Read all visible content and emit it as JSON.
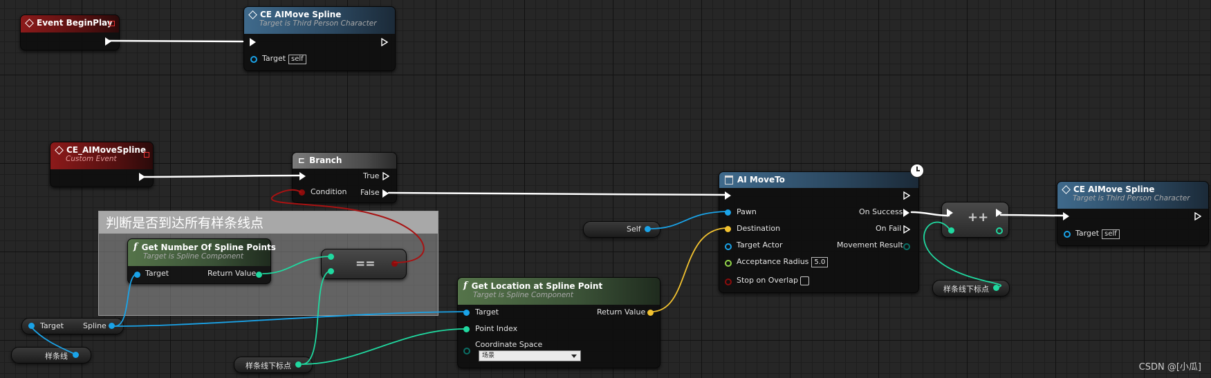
{
  "colors": {
    "exec": "#ffffff",
    "object": "#1aa3e8",
    "vector": "#f2c230",
    "integer": "#20d9a0",
    "float": "#93d64a",
    "boolean": "#8c0c0c",
    "reroute_condition_wire": "#9a1010"
  },
  "comment": {
    "title": "判断是否到达所有样条线点"
  },
  "nodes": {
    "event_beginplay": {
      "title": "Event BeginPlay",
      "icon": "event-diamond-icon"
    },
    "ce_aimove_top": {
      "title": "CE AIMove Spline",
      "subtitle": "Target is Third Person Character",
      "target_label": "Target",
      "target_value": "self"
    },
    "ce_custom_event": {
      "title": "CE_AIMoveSpline",
      "subtitle": "Custom Event"
    },
    "branch": {
      "title": "Branch",
      "condition": "Condition",
      "true_label": "True",
      "false_label": "False"
    },
    "get_num_spline_points": {
      "title": "Get Number Of Spline Points",
      "subtitle": "Target is Spline Component",
      "target": "Target",
      "return_value": "Return Value"
    },
    "equals": {
      "symbol": "=="
    },
    "get_location": {
      "title": "Get Location at Spline Point",
      "subtitle": "Target is Spline Component",
      "target": "Target",
      "return_value": "Return Value",
      "point_index": "Point Index",
      "coordinate_space": "Coordinate Space",
      "coordinate_value": "场景"
    },
    "ai_moveto": {
      "title": "AI MoveTo",
      "pawn": "Pawn",
      "destination": "Destination",
      "target_actor": "Target Actor",
      "acceptance_radius": "Acceptance Radius",
      "acceptance_value": "5.0",
      "stop_on_overlap": "Stop on Overlap",
      "on_success": "On Success",
      "on_fail": "On Fail",
      "movement_result": "Movement Result"
    },
    "increment": {
      "symbol": "++"
    },
    "ce_aimove_right": {
      "title": "CE AIMove Spline",
      "subtitle": "Target is Third Person Character",
      "target_label": "Target",
      "target_value": "self"
    }
  },
  "variables": {
    "self": "Self",
    "target_spline_target": "Target",
    "target_spline_spline": "Spline",
    "spline_var": "样条线",
    "spline_index_bottom": "样条线下标点",
    "spline_index_right": "样条线下标点"
  },
  "watermark": "CSDN @[小瓜]"
}
